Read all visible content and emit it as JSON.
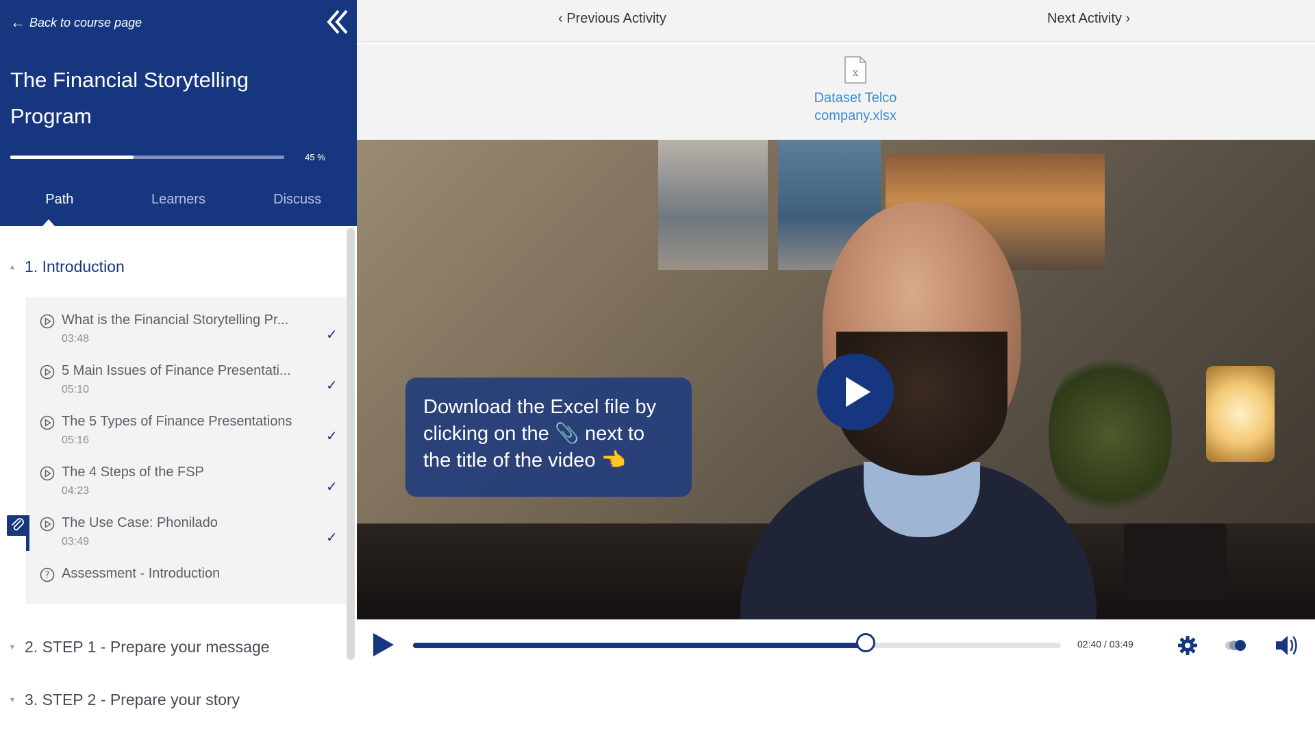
{
  "sidebar": {
    "back_label": "Back to course page",
    "course_title": "The Financial Storytelling Program",
    "progress_percent": 45,
    "progress_label": "45 %",
    "tabs": [
      {
        "label": "Path",
        "active": true
      },
      {
        "label": "Learners",
        "active": false
      },
      {
        "label": "Discuss",
        "active": false
      }
    ],
    "sections": [
      {
        "label": "1. Introduction",
        "expanded": true,
        "lessons": [
          {
            "title": "What is the Financial Storytelling Pr...",
            "duration": "03:48",
            "completed": true,
            "icon": "play-circle-icon"
          },
          {
            "title": "5 Main Issues of Finance Presentati...",
            "duration": "05:10",
            "completed": true,
            "icon": "play-circle-icon"
          },
          {
            "title": "The 5 Types of Finance Presentations",
            "duration": "05:16",
            "completed": true,
            "icon": "play-circle-icon"
          },
          {
            "title": "The 4 Steps of the FSP",
            "duration": "04:23",
            "completed": true,
            "icon": "play-circle-icon"
          },
          {
            "title": "The Use Case: Phonilado",
            "duration": "03:49",
            "completed": true,
            "current": true,
            "icon": "play-circle-icon"
          },
          {
            "title": "Assessment - Introduction",
            "duration": "",
            "completed": false,
            "icon": "question-circle-icon"
          }
        ]
      },
      {
        "label": "2. STEP 1 - Prepare your message",
        "expanded": false
      },
      {
        "label": "3. STEP 2 - Prepare your story",
        "expanded": false
      }
    ],
    "check_glyph": "✓"
  },
  "main": {
    "prev_label": "Previous Activity",
    "next_label": "Next Activity",
    "resource": {
      "file_name": "Dataset Telco company.xlsx",
      "icon": "excel-file-icon"
    },
    "video": {
      "caption": "Download the Excel file by clicking on the 📎 next to the title of the video 👈",
      "current_time": "02:40",
      "duration": "03:49",
      "time_readout": "02:40 / 03:49",
      "played_fraction": 0.699
    }
  },
  "colors": {
    "brand": "#16367f",
    "link": "#3d8bd1",
    "panel_bg": "#f3f3f3"
  }
}
